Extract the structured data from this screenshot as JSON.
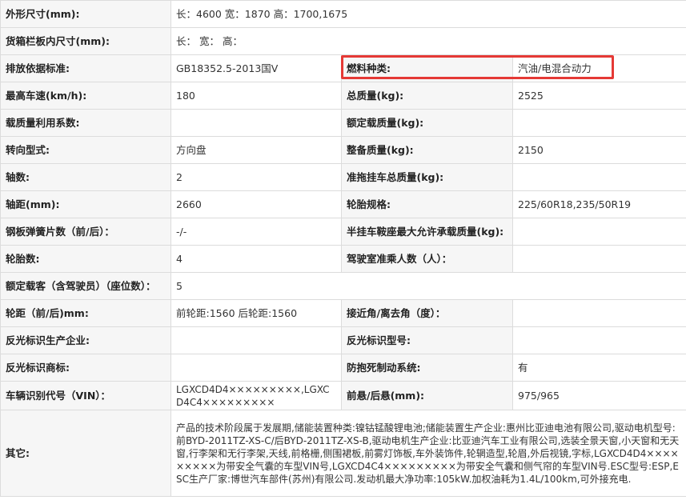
{
  "rows": [
    {
      "l1": "外形尺寸(mm):",
      "v1": "长：4600 宽：1870 高：1700,1675"
    },
    {
      "l1": "货箱栏板内尺寸(mm):",
      "v1": "长： 宽： 高："
    },
    {
      "l1": "排放依据标准:",
      "v1": "GB18352.5-2013国Ⅴ",
      "l2": "燃料种类:",
      "v2": "汽油/电混合动力"
    },
    {
      "l1": "最高车速(km/h):",
      "v1": "180",
      "l2": "总质量(kg):",
      "v2": "2525"
    },
    {
      "l1": "载质量利用系数:",
      "v1": "",
      "l2": "额定载质量(kg):",
      "v2": ""
    },
    {
      "l1": "转向型式:",
      "v1": "方向盘",
      "l2": "整备质量(kg):",
      "v2": "2150"
    },
    {
      "l1": "轴数:",
      "v1": "2",
      "l2": "准拖挂车总质量(kg):",
      "v2": ""
    },
    {
      "l1": "轴距(mm):",
      "v1": "2660",
      "l2": "轮胎规格:",
      "v2": "225/60R18,235/50R19"
    },
    {
      "l1": "钢板弹簧片数（前/后）：",
      "v1": "-/-",
      "l2": "半挂车鞍座最大允许承载质量(kg):",
      "v2": ""
    },
    {
      "l1": "轮胎数:",
      "v1": "4",
      "l2": "驾驶室准乘人数（人）：",
      "v2": ""
    },
    {
      "l1": "额定载客（含驾驶员）（座位数）：",
      "v1": "5"
    },
    {
      "l1": "轮距（前/后)mm:",
      "v1": "前轮距:1560 后轮距:1560",
      "l2": "接近角/离去角（度）：",
      "v2": ""
    },
    {
      "l1": "反光标识生产企业:",
      "v1": "",
      "l2": "反光标识型号:",
      "v2": ""
    },
    {
      "l1": "反光标识商标:",
      "v1": "",
      "l2": "防抱死制动系统:",
      "v2": "有"
    },
    {
      "l1": "车辆识别代号（VIN）：",
      "v1": "LGXCD4D4×××××××××,LGXCD4C4×××××××××",
      "l2": "前悬/后悬(mm):",
      "v2": "975/965"
    },
    {
      "l1": "其它:",
      "v1": "产品的技术阶段属于发展期,储能装置种类:镍钴锰酸锂电池;储能装置生产企业:惠州比亚迪电池有限公司,驱动电机型号:前BYD-2011TZ-XS-C/后BYD-2011TZ-XS-B,驱动电机生产企业:比亚迪汽车工业有限公司,选装全景天窗,小天窗和无天窗,行李架和无行李架,天线,前格栅,侧围裙板,前雾灯饰板,车外装饰件,轮辋造型,轮眉,外后视镜,字标,LGXCD4D4×××××××××为带安全气囊的车型VIN号,LGXCD4C4×××××××××为带安全气囊和侧气帘的车型VIN号.ESC型号:ESP,ESC生产厂家:博世汽车部件(苏州)有限公司.发动机最大净功率:105kW.加权油耗为1.4L/100km,可外接充电."
    }
  ]
}
